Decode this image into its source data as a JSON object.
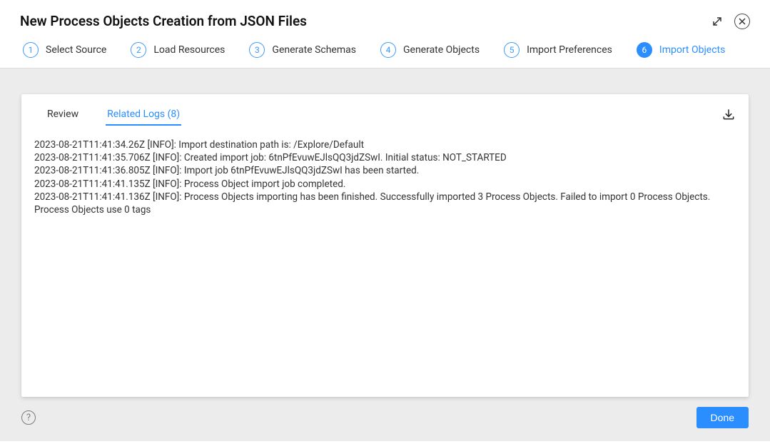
{
  "dialog": {
    "title": "New Process Objects Creation from JSON Files"
  },
  "steps": [
    {
      "num": "1",
      "label": "Select Source",
      "active": false
    },
    {
      "num": "2",
      "label": "Load Resources",
      "active": false
    },
    {
      "num": "3",
      "label": "Generate Schemas",
      "active": false
    },
    {
      "num": "4",
      "label": "Generate Objects",
      "active": false
    },
    {
      "num": "5",
      "label": "Import Preferences",
      "active": false
    },
    {
      "num": "6",
      "label": "Import Objects",
      "active": true
    }
  ],
  "tabs": {
    "review": "Review",
    "related_logs": "Related Logs (8)"
  },
  "logs": [
    "2023-08-21T11:41:34.26Z [INFO]: Import destination path is: /Explore/Default",
    "2023-08-21T11:41:35.706Z [INFO]: Created import job: 6tnPfEvuwEJlsQQ3jdZSwI. Initial status: NOT_STARTED",
    "2023-08-21T11:41:36.805Z [INFO]: Import job 6tnPfEvuwEJlsQQ3jdZSwI has been started.",
    "2023-08-21T11:41:41.135Z [INFO]: Process Object import job completed.",
    "2023-08-21T11:41:41.136Z [INFO]: Process Objects importing has been finished. Successfully imported 3 Process Objects. Failed to import 0 Process Objects. Process Objects use 0 tags"
  ],
  "footer": {
    "done": "Done"
  },
  "icons": {
    "help": "?"
  }
}
